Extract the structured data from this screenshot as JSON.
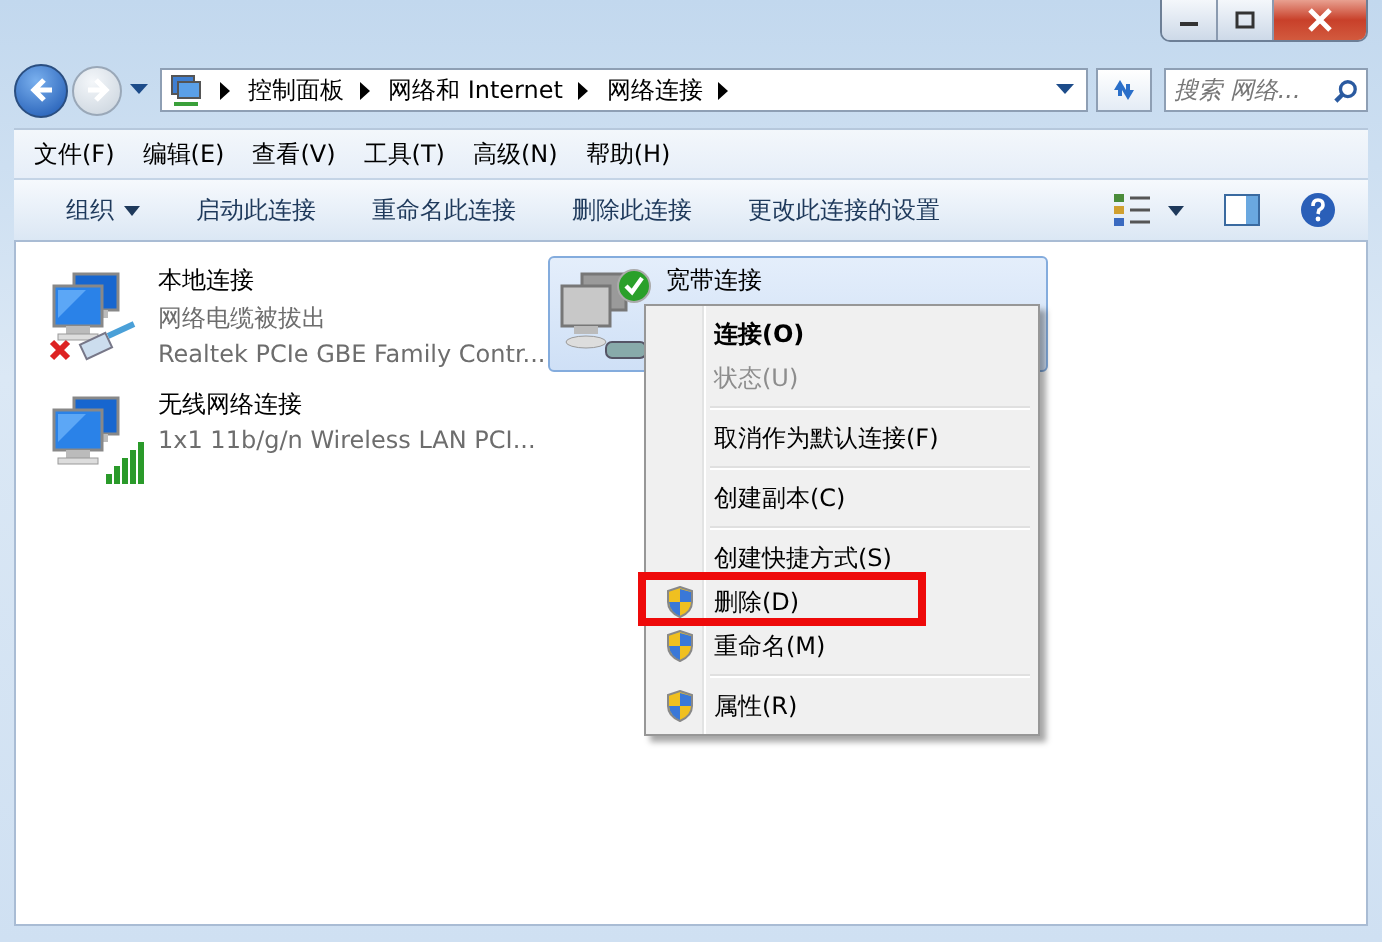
{
  "address_bar": {
    "breadcrumbs": [
      "控制面板",
      "网络和 Internet",
      "网络连接"
    ]
  },
  "search": {
    "placeholder": "搜索 网络..."
  },
  "menu_bar": [
    "文件(F)",
    "编辑(E)",
    "查看(V)",
    "工具(T)",
    "高级(N)",
    "帮助(H)"
  ],
  "command_bar": [
    {
      "label": "组织",
      "dropdown": true
    },
    {
      "label": "启动此连接",
      "dropdown": false
    },
    {
      "label": "重命名此连接",
      "dropdown": false
    },
    {
      "label": "删除此连接",
      "dropdown": false
    },
    {
      "label": "更改此连接的设置",
      "dropdown": false
    }
  ],
  "connections": [
    {
      "kind": "wired",
      "name": "本地连接",
      "status": "网络电缆被拔出",
      "adapter": "Realtek PCIe GBE Family Contr...",
      "selected": false
    },
    {
      "kind": "broadband",
      "name": "宽带连接",
      "selected": true
    },
    {
      "kind": "wireless",
      "name": "无线网络连接",
      "adapter": "1x1 11b/g/n Wireless LAN PCI...",
      "selected": false
    }
  ],
  "context_menu": {
    "groups": [
      [
        {
          "label": "连接(O)",
          "default": true,
          "disabled": false,
          "shield": false,
          "annotated": false
        },
        {
          "label": "状态(U)",
          "default": false,
          "disabled": true,
          "shield": false,
          "annotated": false
        }
      ],
      [
        {
          "label": "取消作为默认连接(F)",
          "default": false,
          "disabled": false,
          "shield": false,
          "annotated": false
        }
      ],
      [
        {
          "label": "创建副本(C)",
          "default": false,
          "disabled": false,
          "shield": false,
          "annotated": false
        }
      ],
      [
        {
          "label": "创建快捷方式(S)",
          "default": false,
          "disabled": false,
          "shield": false,
          "annotated": false
        },
        {
          "label": "删除(D)",
          "default": false,
          "disabled": false,
          "shield": true,
          "annotated": true
        },
        {
          "label": "重命名(M)",
          "default": false,
          "disabled": false,
          "shield": true,
          "annotated": false
        }
      ],
      [
        {
          "label": "属性(R)",
          "default": false,
          "disabled": false,
          "shield": true,
          "annotated": false
        }
      ]
    ]
  }
}
